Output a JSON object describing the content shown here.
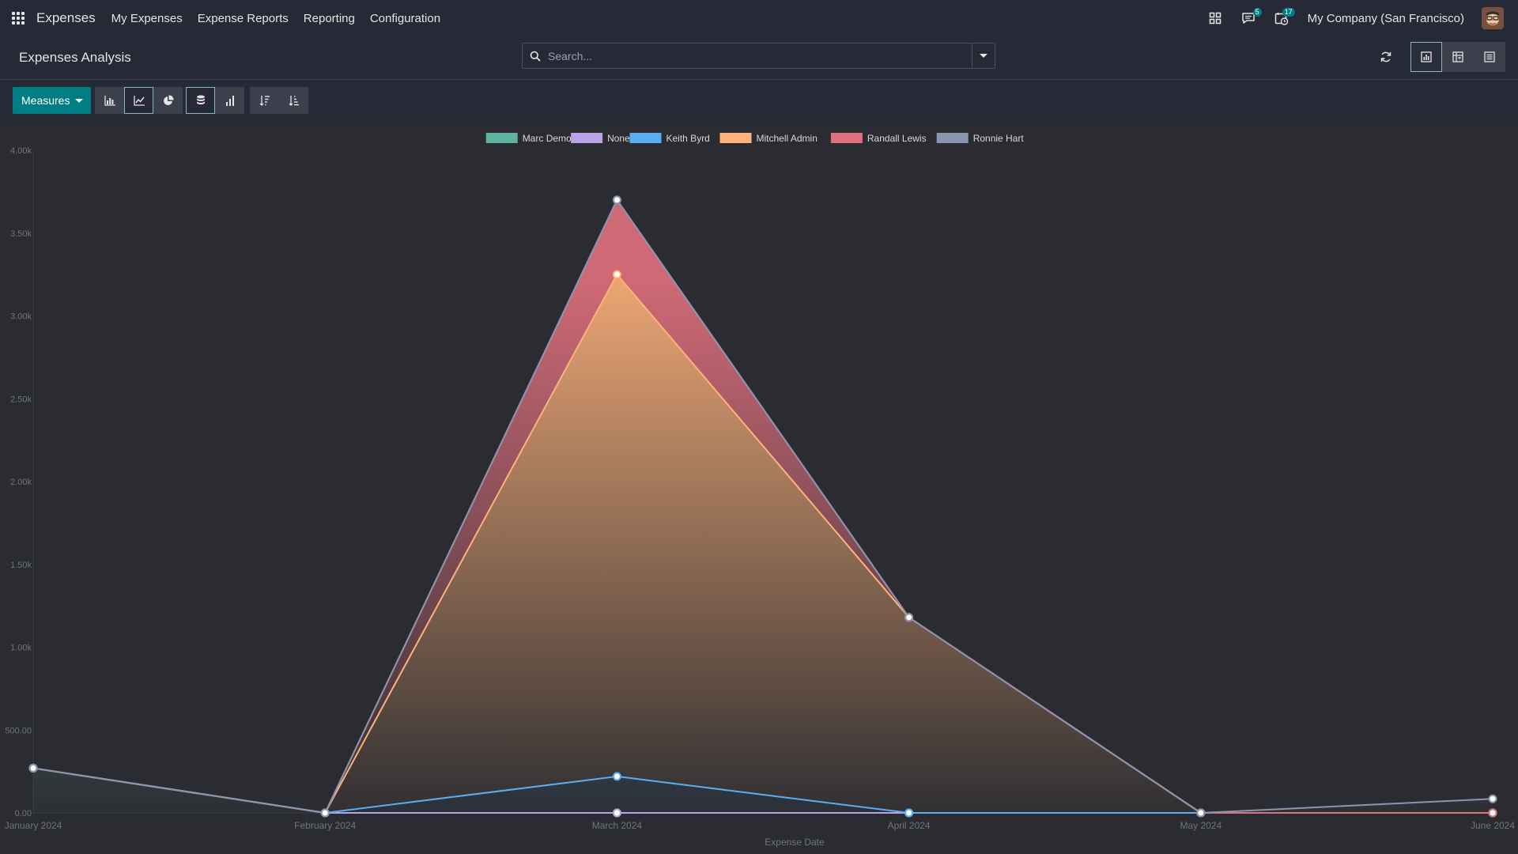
{
  "navbar": {
    "apps_icon": "grid-icon",
    "brand": "Expenses",
    "menu": [
      {
        "label": "My Expenses"
      },
      {
        "label": "Expense Reports"
      },
      {
        "label": "Reporting"
      },
      {
        "label": "Configuration"
      }
    ],
    "messages_badge": "5",
    "activities_badge": "17",
    "company": "My Company (San Francisco)"
  },
  "control_panel": {
    "title": "Expenses Analysis",
    "search_placeholder": "Search...",
    "measures_label": "Measures",
    "active_view": "graph",
    "active_chart_mode": "line",
    "stacked": true
  },
  "colors": {
    "accent": "#017e84",
    "Marc Demo": "#5fb3a3",
    "None": "#b9a2e6",
    "Keith Byrd": "#5aaef2",
    "Mitchell Admin": "#ffb27a",
    "Randall Lewis": "#e0707d",
    "Ronnie Hart": "#8a95b0"
  },
  "chart_data": {
    "type": "area",
    "stacked": true,
    "xlabel": "Expense Date",
    "ylabel": "",
    "ylim": [
      0,
      4000
    ],
    "yticks": [
      "0.00",
      "500.00",
      "1.00k",
      "1.50k",
      "2.00k",
      "2.50k",
      "3.00k",
      "3.50k",
      "4.00k"
    ],
    "categories": [
      "January 2024",
      "February 2024",
      "March 2024",
      "April 2024",
      "May 2024",
      "June 2024"
    ],
    "legend_position": "top-center",
    "series": [
      {
        "name": "Marc Demo",
        "values": [
          270,
          0,
          0,
          0,
          0,
          0
        ]
      },
      {
        "name": "None",
        "values": [
          0,
          0,
          0,
          0,
          0,
          0
        ]
      },
      {
        "name": "Keith Byrd",
        "values": [
          0,
          0,
          220,
          0,
          0,
          0
        ]
      },
      {
        "name": "Mitchell Admin",
        "values": [
          0,
          0,
          3030,
          1180,
          0,
          0
        ]
      },
      {
        "name": "Randall Lewis",
        "values": [
          0,
          0,
          450,
          0,
          0,
          0
        ]
      },
      {
        "name": "Ronnie Hart",
        "values": [
          0,
          0,
          0,
          0,
          0,
          85
        ]
      }
    ]
  }
}
